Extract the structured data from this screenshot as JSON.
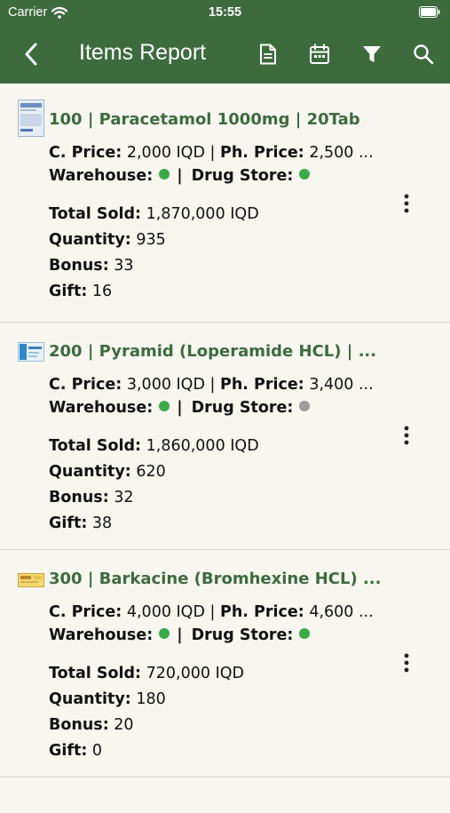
{
  "status_bar": {
    "carrier": "Carrier",
    "time": "15:55"
  },
  "nav": {
    "title": "Items Report",
    "icons": [
      "back-chevron-icon",
      "document-icon",
      "calendar-icon",
      "filter-icon",
      "search-icon"
    ]
  },
  "labels": {
    "c_price": "C. Price:",
    "ph_price": "Ph. Price:",
    "warehouse": "Warehouse:",
    "drug_store": "Drug Store:",
    "total_sold": "Total Sold:",
    "quantity": "Quantity:",
    "bonus": "Bonus:",
    "gift": "Gift:",
    "separator": "|"
  },
  "colors": {
    "header": "#3d6b3d",
    "title": "#3d6b3d",
    "status_active": "#3aaa48",
    "status_inactive": "#9e9e9e"
  },
  "items": [
    {
      "title": "100 | Paracetamol 1000mg | 20Tab",
      "c_price": "2,000 IQD",
      "ph_price_text": "2,500 ...",
      "warehouse_status": "active",
      "drug_store_status": "active",
      "total_sold": "1,870,000 IQD",
      "quantity": "935",
      "bonus": "33",
      "gift": "16"
    },
    {
      "title": "200 | Pyramid (Loperamide HCL) | ...",
      "c_price": "3,000 IQD",
      "ph_price_text": "3,400 ...",
      "warehouse_status": "active",
      "drug_store_status": "inactive",
      "total_sold": "1,860,000 IQD",
      "quantity": "620",
      "bonus": "32",
      "gift": "38"
    },
    {
      "title": "300 | Barkacine (Bromhexine HCL) ...",
      "c_price": "4,000 IQD",
      "ph_price_text": "4,600 ...",
      "warehouse_status": "active",
      "drug_store_status": "active",
      "total_sold": "720,000 IQD",
      "quantity": "180",
      "bonus": "20",
      "gift": "0"
    }
  ]
}
